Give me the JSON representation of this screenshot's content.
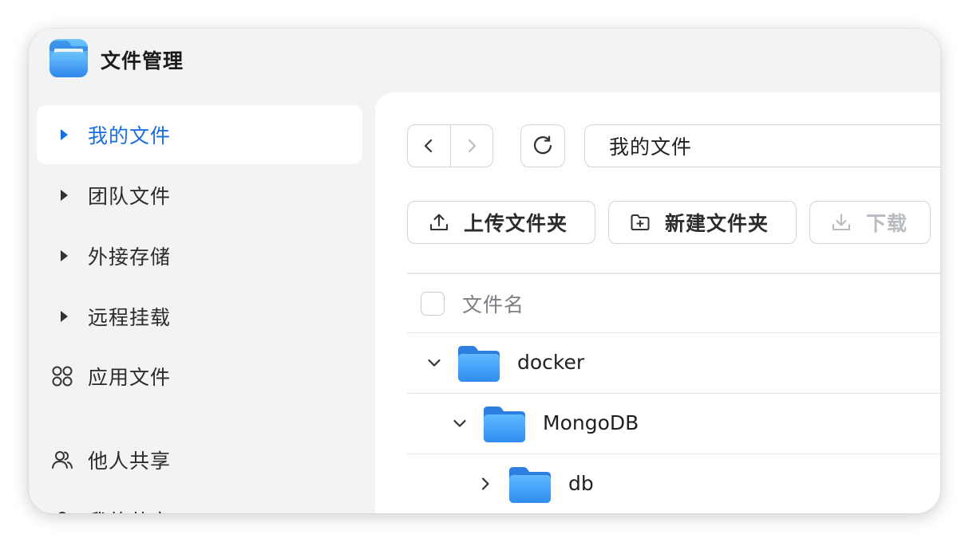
{
  "app": {
    "title": "文件管理",
    "icon": "folder-app-icon"
  },
  "sidebar": {
    "items": [
      {
        "label": "我的文件",
        "icon": "caret-right-icon",
        "active": true
      },
      {
        "label": "团队文件",
        "icon": "caret-right-icon",
        "active": false
      },
      {
        "label": "外接存储",
        "icon": "caret-right-icon",
        "active": false
      },
      {
        "label": "远程挂载",
        "icon": "caret-right-icon",
        "active": false
      },
      {
        "label": "应用文件",
        "icon": "apps-grid-icon",
        "active": false
      },
      {
        "label": "他人共享",
        "icon": "users-icon",
        "active": false
      },
      {
        "label": "我的共享",
        "icon": "user-icon",
        "active": false
      }
    ]
  },
  "navigation": {
    "path": "我的文件"
  },
  "toolbar": {
    "upload_label": "上传文件夹",
    "new_folder_label": "新建文件夹",
    "download_label": "下载"
  },
  "table": {
    "column_name": "文件名",
    "rows": [
      {
        "name": "docker",
        "expanded": true,
        "depth": 0
      },
      {
        "name": "MongoDB",
        "expanded": true,
        "depth": 1
      },
      {
        "name": "db",
        "expanded": false,
        "depth": 2
      }
    ]
  },
  "colors": {
    "accent": "#1a6fe0",
    "sidebar_bg": "#f2f3f5",
    "folder": "#3d9cf2"
  }
}
